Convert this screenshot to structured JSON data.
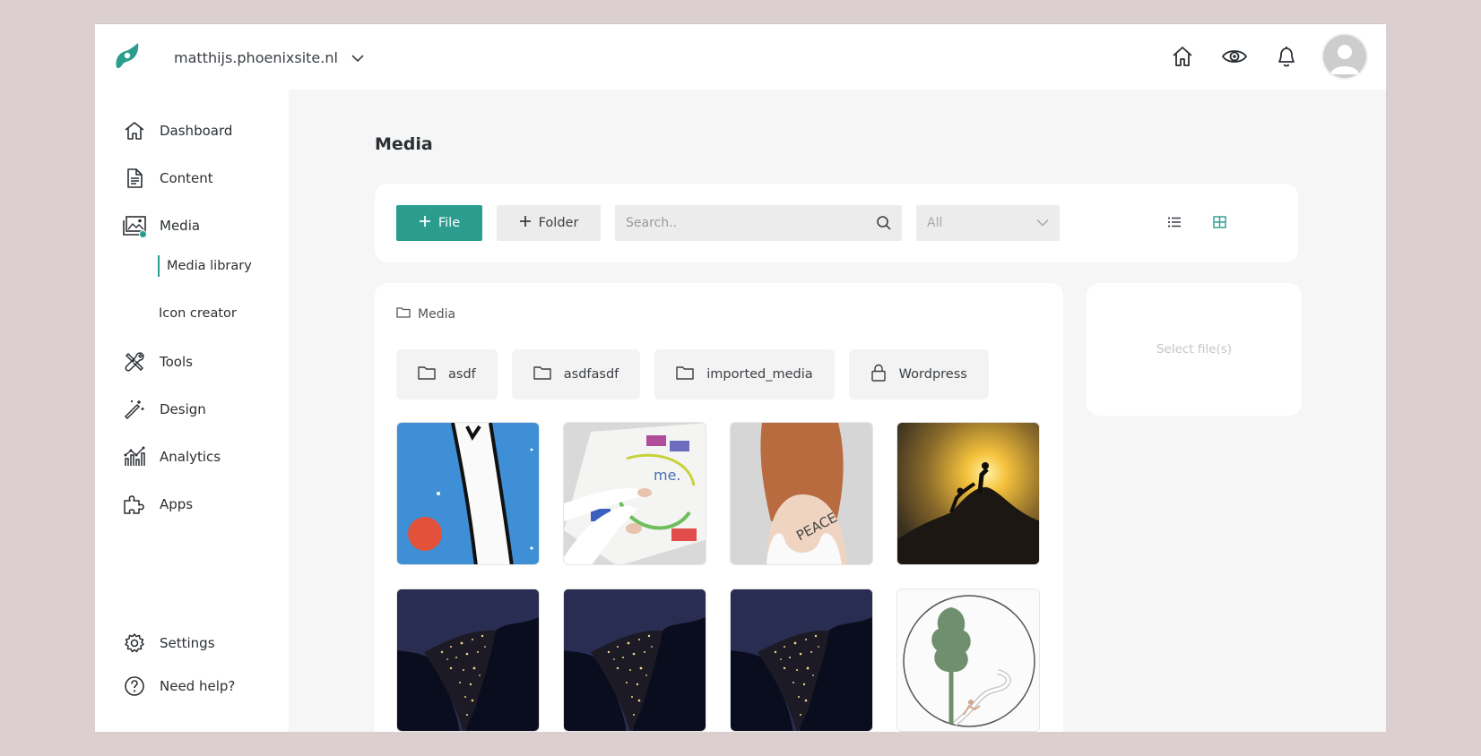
{
  "header": {
    "site_name": "matthijs.phoenixsite.nl",
    "icons": [
      "home-icon",
      "eye-icon",
      "bell-icon",
      "avatar"
    ]
  },
  "sidebar": {
    "items": [
      {
        "label": "Dashboard",
        "icon": "home-icon"
      },
      {
        "label": "Content",
        "icon": "document-icon"
      },
      {
        "label": "Media",
        "icon": "image-icon"
      },
      {
        "label": "Tools",
        "icon": "tools-icon"
      },
      {
        "label": "Design",
        "icon": "magic-wand-icon"
      },
      {
        "label": "Analytics",
        "icon": "analytics-icon"
      },
      {
        "label": "Apps",
        "icon": "puzzle-icon"
      }
    ],
    "subitems": [
      {
        "label": "Media library",
        "active": true
      },
      {
        "label": "Icon creator",
        "active": false
      }
    ],
    "bottom": [
      {
        "label": "Settings",
        "icon": "gear-icon"
      },
      {
        "label": "Need help?",
        "icon": "help-icon"
      }
    ]
  },
  "main": {
    "title": "Media",
    "toolbar": {
      "file_label": "File",
      "folder_label": "Folder",
      "search_placeholder": "Search..",
      "filter_value": "All"
    },
    "breadcrumb": "Media",
    "folders": [
      {
        "name": "asdf",
        "icon": "folder-icon"
      },
      {
        "name": "asdfasdf",
        "icon": "folder-icon"
      },
      {
        "name": "imported_media",
        "icon": "folder-icon"
      },
      {
        "name": "Wordpress",
        "icon": "lock-icon"
      }
    ],
    "side_panel_text": "Select file(s)"
  },
  "colors": {
    "accent": "#2a9d8f",
    "background": "#dccfcf",
    "main_bg": "#f6f6f6"
  }
}
